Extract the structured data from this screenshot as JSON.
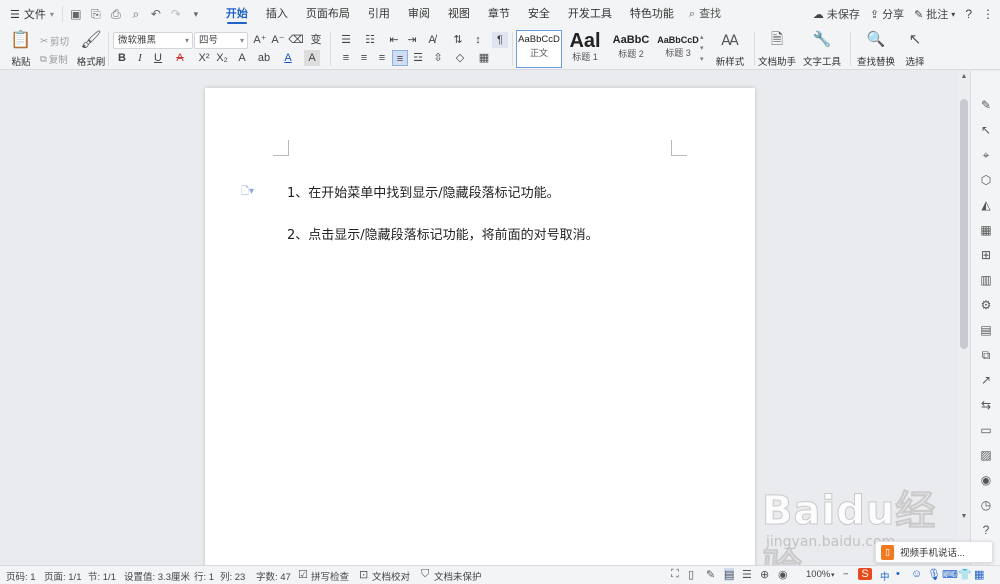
{
  "menubar": {
    "file": "文件",
    "tabs": [
      "开始",
      "插入",
      "页面布局",
      "引用",
      "审阅",
      "视图",
      "章节",
      "安全",
      "开发工具",
      "特色功能"
    ],
    "active_tab": "开始",
    "search": "查找",
    "unsaved": "未保存",
    "share": "分享",
    "comment": "批注",
    "help": "?",
    "more": "⋮"
  },
  "ribbon": {
    "paste": "粘贴",
    "cut": "剪切",
    "copy": "复制",
    "format_painter": "格式刷",
    "font_name": "微软雅黑",
    "font_size": "四号",
    "styles": [
      {
        "sample": "AaBbCcD",
        "name": "正文"
      },
      {
        "sample": "Aal",
        "name": "标题 1"
      },
      {
        "sample": "AaBbC",
        "name": "标题 2"
      },
      {
        "sample": "AaBbCcD",
        "name": "标题 3"
      }
    ],
    "new_style": "新样式",
    "doc_assistant": "文档助手",
    "text_tools": "文字工具",
    "find_replace": "查找替换",
    "select": "选择"
  },
  "document": {
    "paragraphs": [
      "1、在开始菜单中找到显示/隐藏段落标记功能。",
      "2、点击显示/隐藏段落标记功能，将前面的对号取消。"
    ]
  },
  "statusbar": {
    "page_no": "页码: 1",
    "pages": "页面: 1/1",
    "section": "节: 1/1",
    "setting": "设置值: 3.3厘米",
    "row": "行: 1",
    "col": "列: 23",
    "words": "字数: 47",
    "spell": "拼写检查",
    "proof": "文档校对",
    "protect": "文档未保护",
    "zoom": "100%"
  },
  "popup": {
    "text": "视频手机说话..."
  },
  "watermark": {
    "brand": "Baidu经验",
    "url": "jingyan.baidu.com"
  },
  "colors": {
    "accent": "#2062c8",
    "ribbon_bg": "#f3f4f6",
    "workspace_bg": "#e9ebee"
  }
}
